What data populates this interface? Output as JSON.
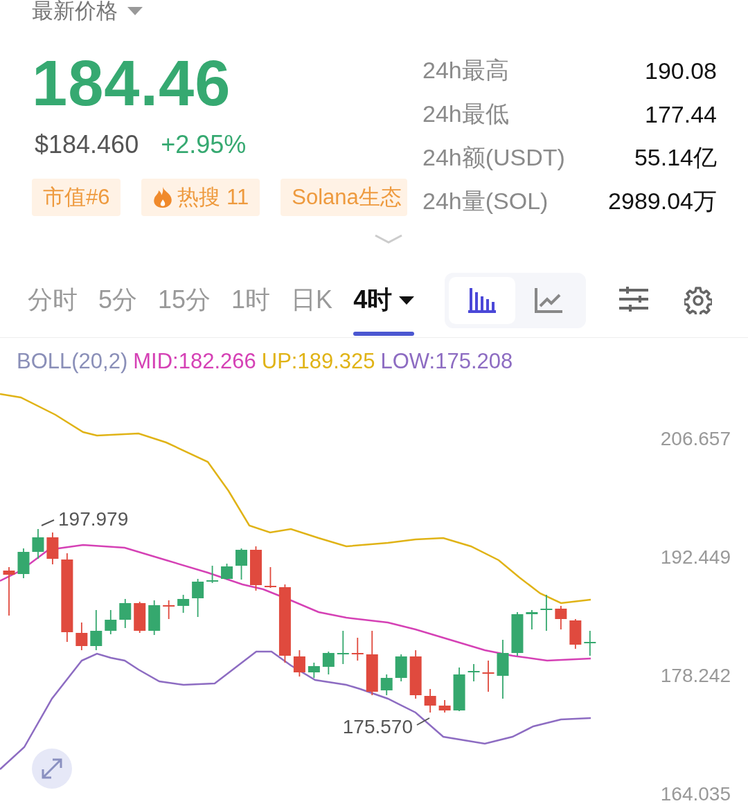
{
  "header": {
    "title": "最新价格"
  },
  "price": {
    "last": "184.46",
    "usd": "$184.460",
    "change": "+2.95%"
  },
  "tags": [
    {
      "kind": "plain",
      "label": "市值#6"
    },
    {
      "kind": "hot",
      "label": "热搜 11"
    },
    {
      "kind": "plain",
      "label": "Solana生态"
    }
  ],
  "stats": [
    {
      "label": "24h最高",
      "value": "190.08"
    },
    {
      "label": "24h最低",
      "value": "177.44"
    },
    {
      "label": "24h额(USDT)",
      "value": "55.14亿"
    },
    {
      "label": "24h量(SOL)",
      "value": "2989.04万"
    }
  ],
  "intervals": [
    {
      "label": "分时",
      "kind": "plain",
      "selected": false
    },
    {
      "label": "5分",
      "kind": "plain",
      "selected": false
    },
    {
      "label": "15分",
      "kind": "plain",
      "selected": false
    },
    {
      "label": "1时",
      "kind": "plain",
      "selected": false
    },
    {
      "label": "日K",
      "kind": "plain",
      "selected": false
    },
    {
      "label": "4时",
      "kind": "dropdown",
      "selected": true
    }
  ],
  "chart_types": [
    {
      "kind": "candles",
      "selected": true
    },
    {
      "kind": "line",
      "selected": false
    }
  ],
  "indicator": {
    "name": "BOLL(20,2)",
    "mid": "MID:182.266",
    "up": "UP:189.325",
    "low": "LOW:175.208"
  },
  "chart": {
    "y_labels": [
      "206.657",
      "192.449",
      "178.242",
      "164.035"
    ],
    "high_label": "197.979",
    "low_label": "175.570"
  }
}
